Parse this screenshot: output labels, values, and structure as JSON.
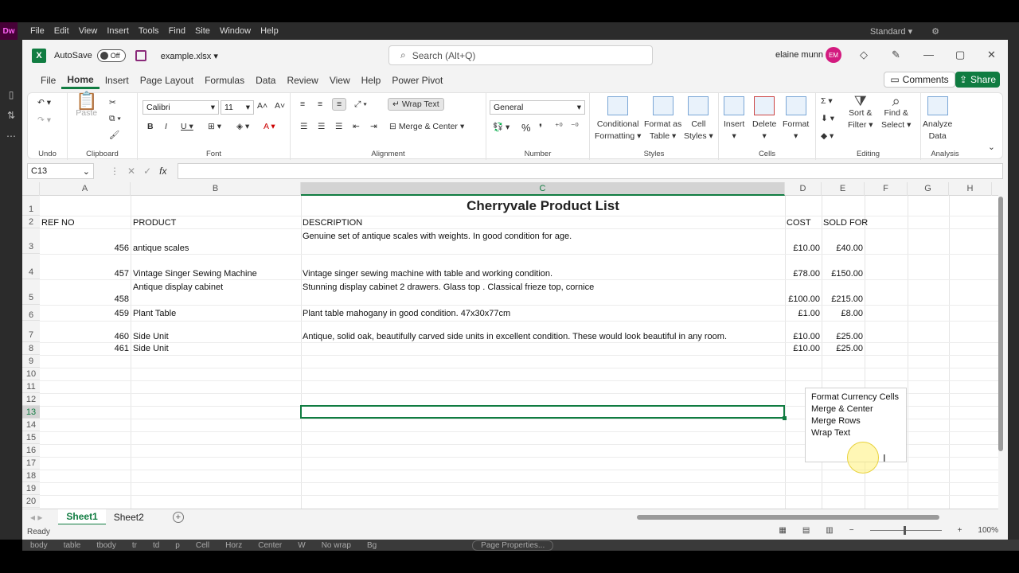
{
  "host": {
    "logo": "Dw",
    "menus": [
      "File",
      "Edit",
      "View",
      "Insert",
      "Tools",
      "Find",
      "Site",
      "Window",
      "Help"
    ],
    "workspace": "Standard",
    "status_tags": [
      "body",
      "table",
      "tbody",
      "tr",
      "td",
      "p"
    ],
    "status_fields": [
      "Cell",
      "Horz",
      "Center",
      "W",
      "No wrap",
      "Bg"
    ],
    "page_properties": "Page Properties..."
  },
  "titlebar": {
    "autosave_label": "AutoSave",
    "autosave_state": "Off",
    "file_name": "example.xlsx",
    "search_placeholder": "Search (Alt+Q)",
    "user_name": "elaine munn",
    "user_initials": "EM"
  },
  "tabs": [
    "File",
    "Home",
    "Insert",
    "Page Layout",
    "Formulas",
    "Data",
    "Review",
    "View",
    "Help",
    "Power Pivot"
  ],
  "active_tab": "Home",
  "comments_label": "Comments",
  "share_label": "Share",
  "ribbon": {
    "undo_label": "Undo",
    "clipboard_label": "Clipboard",
    "paste_label": "Paste",
    "font_label": "Font",
    "font_name": "Calibri",
    "font_size": "11",
    "alignment_label": "Alignment",
    "wrap_text": "Wrap Text",
    "merge_center": "Merge & Center",
    "number_label": "Number",
    "number_format": "General",
    "styles_label": "Styles",
    "conditional_formatting": [
      "Conditional",
      "Formatting"
    ],
    "format_as_table": [
      "Format as",
      "Table"
    ],
    "cell_styles": [
      "Cell",
      "Styles"
    ],
    "cells_label": "Cells",
    "insert": "Insert",
    "delete": "Delete",
    "format": "Format",
    "editing_label": "Editing",
    "sort_filter": [
      "Sort &",
      "Filter"
    ],
    "find_select": [
      "Find &",
      "Select"
    ],
    "analysis_label": "Analysis",
    "analyze_data": [
      "Analyze",
      "Data"
    ]
  },
  "name_box": "C13",
  "fx": "fx",
  "columns": [
    "A",
    "B",
    "C",
    "D",
    "E",
    "F",
    "G",
    "H"
  ],
  "selected_column": "C",
  "rows": [
    "1",
    "2",
    "3",
    "4",
    "5",
    "6",
    "7",
    "8",
    "9",
    "10",
    "11",
    "12",
    "13",
    "14",
    "15",
    "16",
    "17",
    "18",
    "19",
    "20"
  ],
  "selected_row": "13",
  "sheet": {
    "title": "Cherryvale Product List",
    "headers": [
      "REF NO",
      "PRODUCT",
      "DESCRIPTION",
      "COST",
      "SOLD FOR"
    ],
    "records": [
      {
        "ref": "456",
        "product": "antique scales",
        "description": "Genuine set of antique scales with weights. In good condition for age.",
        "cost": "£10.00",
        "sold": "£40.00"
      },
      {
        "ref": "457",
        "product": "Vintage Singer Sewing Machine",
        "description": "Vintage singer sewing machine with table and working condition.",
        "cost": "£78.00",
        "sold": "£150.00"
      },
      {
        "ref": "458",
        "product": "Antique display cabinet",
        "description": "Stunning display cabinet 2 drawers. Glass top . Classical frieze top, cornice",
        "cost": "£100.00",
        "sold": "£215.00"
      },
      {
        "ref": "459",
        "product": "Plant Table",
        "description": "Plant table mahogany in good condition. 47x30x77cm",
        "cost": "£1.00",
        "sold": "£8.00"
      },
      {
        "ref": "460",
        "product": "Side Unit",
        "description": "Antique, solid oak, beautifully carved side units in excellent condition. These would look beautiful in any room.",
        "cost": "£10.00",
        "sold": "£25.00"
      },
      {
        "ref": "461",
        "product": "Side Unit",
        "description": "",
        "cost": "£10.00",
        "sold": "£25.00"
      }
    ]
  },
  "popup_items": [
    "Format Currency Cells",
    "Merge & Center",
    "Merge Rows",
    "Wrap Text"
  ],
  "sheet_tabs": [
    "Sheet1",
    "Sheet2"
  ],
  "active_sheet": "Sheet1",
  "status": "Ready",
  "zoom": "100%"
}
